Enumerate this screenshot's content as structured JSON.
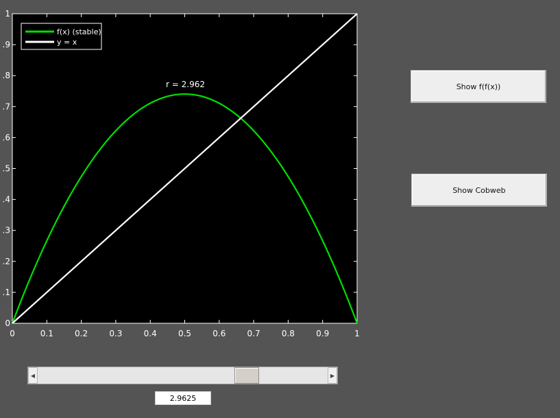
{
  "chart_data": {
    "type": "line",
    "annotation": "r = 2.962",
    "x_ticks": [
      "0",
      "0.1",
      "0.2",
      "0.3",
      "0.4",
      "0.5",
      "0.6",
      "0.7",
      "0.8",
      "0.9",
      "1"
    ],
    "y_ticks": [
      "0",
      "0.1",
      "0.2",
      "0.3",
      "0.4",
      "0.5",
      "0.6",
      "0.7",
      "0.8",
      "0.9",
      "1"
    ],
    "xlim": [
      0,
      1
    ],
    "ylim": [
      0,
      1
    ],
    "grid": false,
    "legend_position": "top-left",
    "background": "#000000",
    "series": [
      {
        "name": "f(x) (stable)",
        "color": "#00e000",
        "r": 2.962,
        "x": [
          0,
          0.05,
          0.1,
          0.15,
          0.2,
          0.25,
          0.3,
          0.35,
          0.4,
          0.45,
          0.5,
          0.55,
          0.6,
          0.65,
          0.7,
          0.75,
          0.8,
          0.85,
          0.9,
          0.95,
          1
        ],
        "y": [
          0,
          0.1407,
          0.2666,
          0.3777,
          0.474,
          0.5554,
          0.622,
          0.6738,
          0.7109,
          0.7331,
          0.7405,
          0.7331,
          0.7109,
          0.6738,
          0.622,
          0.5554,
          0.474,
          0.3777,
          0.2666,
          0.1407,
          0
        ]
      },
      {
        "name": "y = x",
        "color": "#ffffff",
        "x": [
          0,
          1
        ],
        "y": [
          0,
          1
        ]
      }
    ]
  },
  "controls": {
    "btn_ffx_label": "Show f(f(x))",
    "btn_cobweb_label": "Show Cobweb",
    "slider_value": 2.9625,
    "slider_min": 0,
    "slider_max": 4,
    "value_text": "2.9625"
  }
}
